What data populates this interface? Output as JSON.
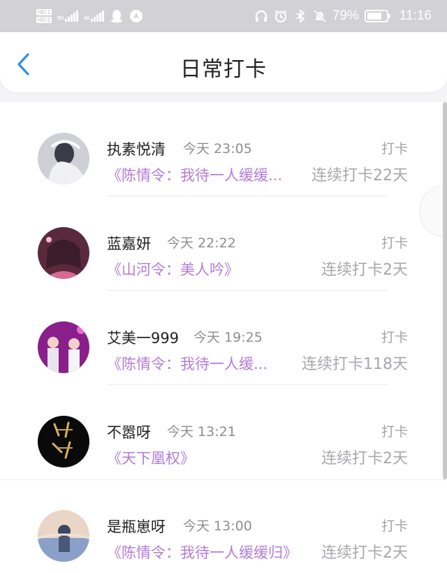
{
  "status_bar": {
    "hd_badges": [
      "HD 1",
      "HD 2"
    ],
    "signal_1": "5G",
    "signal_2": "4G",
    "battery_percent": "79%",
    "battery_level": 0.79,
    "time": "11:16"
  },
  "header": {
    "back_icon": "chevron-left-icon",
    "title": "日常打卡"
  },
  "colors": {
    "accent_blue": "#2f8fe8",
    "book_title": "#b47cd8",
    "muted": "#a4a4a8"
  },
  "items": [
    {
      "name": "执素悦清",
      "time": "今天 23:05",
      "action": "打卡",
      "book": "《陈情令：我待一人缓缓...",
      "streak": "连续打卡22天"
    },
    {
      "name": "蓝嘉妍",
      "time": "今天 22:22",
      "action": "打卡",
      "book": "《山河令：美人吟》",
      "streak": "连续打卡2天"
    },
    {
      "name": "艾美一999",
      "time": "今天 19:25",
      "action": "打卡",
      "book": "《陈情令：我待一人缓...",
      "streak": "连续打卡118天"
    },
    {
      "name": "不嚣呀",
      "time": "今天 13:21",
      "action": "打卡",
      "book": "《天下凰权》",
      "streak": "连续打卡2天"
    },
    {
      "name": "是瓶崽呀",
      "time": "今天 13:00",
      "action": "打卡",
      "book": "《陈情令：我待一人缓缓归》",
      "streak": "连续打卡2天"
    }
  ]
}
